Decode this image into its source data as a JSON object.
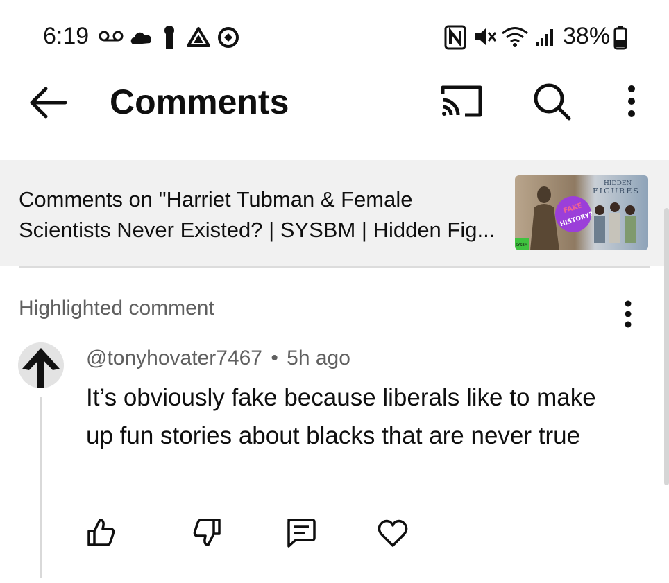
{
  "status_bar": {
    "time": "6:19",
    "battery": "38%",
    "left_icons": [
      "voicemail-icon",
      "cloud-icon",
      "keyhole-icon",
      "drive-icon",
      "sync-icon"
    ],
    "right_icons": [
      "nfc-icon",
      "mute-icon",
      "wifi-icon",
      "signal-icon",
      "battery-icon"
    ]
  },
  "top_bar": {
    "title": "Comments",
    "icons": [
      "back-arrow-icon",
      "cast-icon",
      "search-icon",
      "more-vert-icon"
    ]
  },
  "video_banner": {
    "text": "Comments on \"Harriet Tubman & Female Scientists Never Existed? | SYSBM | Hidden Fig...",
    "thumbnail": {
      "title_lines": [
        "HIDDEN",
        "FIGURES"
      ],
      "badge_top": "FAKE",
      "badge_bottom": "HISTORY?",
      "corner_tag": "SYSBM"
    }
  },
  "highlighted": {
    "label": "Highlighted comment",
    "comment": {
      "author": "@tonyhovater7467",
      "separator": "•",
      "time": "5h ago",
      "text": "It’s obviously fake because liberals like to make up fun stories about blacks that are never true",
      "actions": [
        "like-icon",
        "dislike-icon",
        "reply-icon",
        "heart-icon"
      ]
    }
  },
  "colors": {
    "text_primary": "#0f0f0f",
    "text_secondary": "#606060",
    "banner_bg": "#f1f1f1",
    "badge_purple": "#9b3fd9"
  }
}
